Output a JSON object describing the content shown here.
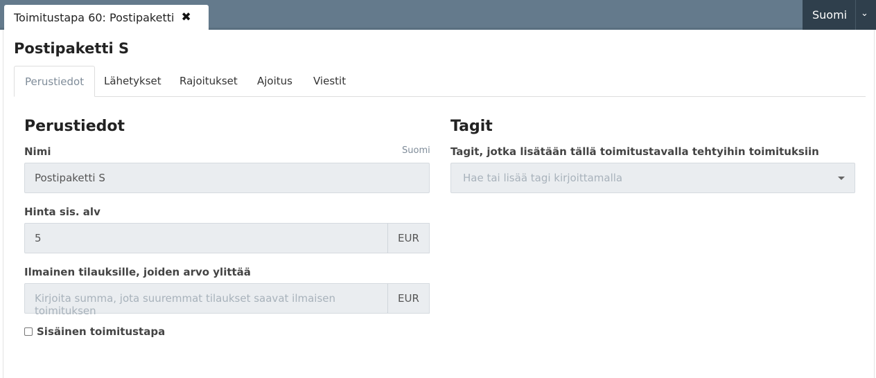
{
  "header": {
    "doc_tab_title": "Toimitustapa 60: Postipaketti",
    "close_icon_glyph": "✖",
    "language_button": "Suomi",
    "chevron_glyph": "⌄"
  },
  "page": {
    "title": "Postipaketti S"
  },
  "tabs": [
    {
      "label": "Perustiedot",
      "active": true
    },
    {
      "label": "Lähetykset",
      "active": false
    },
    {
      "label": "Rajoitukset",
      "active": false
    },
    {
      "label": "Ajoitus",
      "active": false
    },
    {
      "label": "Viestit",
      "active": false
    }
  ],
  "basic": {
    "heading": "Perustiedot",
    "name_label": "Nimi",
    "name_lang_hint": "Suomi",
    "name_value": "Postipaketti S",
    "price_label": "Hinta sis. alv",
    "price_value": "5",
    "price_currency": "EUR",
    "free_label": "Ilmainen tilauksille, joiden arvo ylittää",
    "free_placeholder": "Kirjoita summa, jota suuremmat tilaukset saavat ilmaisen toimituksen",
    "free_currency": "EUR",
    "internal_label": "Sisäinen toimitustapa",
    "internal_checked": false
  },
  "tags": {
    "heading": "Tagit",
    "label": "Tagit, jotka lisätään tällä toimitustavalla tehtyihin toimituksiin",
    "placeholder": "Hae tai lisää tagi kirjoittamalla"
  }
}
